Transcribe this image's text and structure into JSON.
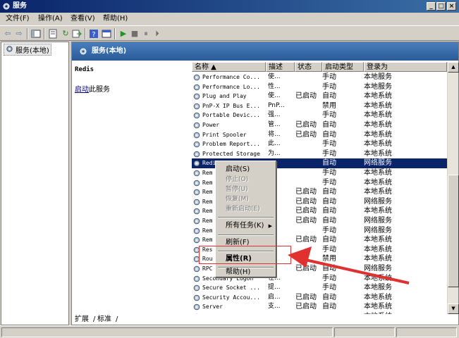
{
  "window": {
    "title": "服务",
    "buttons": [
      "_",
      "□",
      "×"
    ]
  },
  "menu": {
    "items": [
      "文件(F)",
      "操作(A)",
      "查看(V)",
      "帮助(H)"
    ]
  },
  "tree": {
    "root_label": "服务(本地)"
  },
  "panel": {
    "header": "服务(本地)",
    "selected_service": "Redis",
    "start_link": "启动",
    "start_link_suffix": "此服务"
  },
  "columns": [
    "名称 ▲",
    "描述",
    "状态",
    "启动类型",
    "登录为"
  ],
  "services": [
    {
      "name": "Performance Co...",
      "desc": "使...",
      "status": "",
      "startup": "手动",
      "logon": "本地服务"
    },
    {
      "name": "Performance Lo...",
      "desc": "性...",
      "status": "",
      "startup": "手动",
      "logon": "本地服务"
    },
    {
      "name": "Plug and Play",
      "desc": "使...",
      "status": "已启动",
      "startup": "自动",
      "logon": "本地系统"
    },
    {
      "name": "PnP-X IP Bus E...",
      "desc": "PnP...",
      "status": "",
      "startup": "禁用",
      "logon": "本地系统"
    },
    {
      "name": "Portable Devic...",
      "desc": "强...",
      "status": "",
      "startup": "手动",
      "logon": "本地系统"
    },
    {
      "name": "Power",
      "desc": "管...",
      "status": "已启动",
      "startup": "自动",
      "logon": "本地系统"
    },
    {
      "name": "Print Spooler",
      "desc": "将...",
      "status": "已启动",
      "startup": "自动",
      "logon": "本地系统"
    },
    {
      "name": "Problem Report...",
      "desc": "此...",
      "status": "",
      "startup": "手动",
      "logon": "本地系统"
    },
    {
      "name": "Protected Storage",
      "desc": "为...",
      "status": "",
      "startup": "手动",
      "logon": "本地系统"
    },
    {
      "name": "Redis",
      "desc": "",
      "status": "",
      "startup": "自动",
      "logon": "网络服务"
    },
    {
      "name": "Rem",
      "desc": "...",
      "status": "",
      "startup": "手动",
      "logon": "本地系统"
    },
    {
      "name": "Rem",
      "desc": "...",
      "status": "",
      "startup": "手动",
      "logon": "本地系统"
    },
    {
      "name": "Rem",
      "desc": "...",
      "status": "已启动",
      "startup": "自动",
      "logon": "本地系统"
    },
    {
      "name": "Rem",
      "desc": "...",
      "status": "已启动",
      "startup": "自动",
      "logon": "网络服务"
    },
    {
      "name": "Rem",
      "desc": "...",
      "status": "已启动",
      "startup": "自动",
      "logon": "本地系统"
    },
    {
      "name": "Rem",
      "desc": "...",
      "status": "已启动",
      "startup": "自动",
      "logon": "网络服务"
    },
    {
      "name": "Rem",
      "desc": "...",
      "status": "",
      "startup": "手动",
      "logon": "网络服务"
    },
    {
      "name": "Rem",
      "desc": "...",
      "status": "已启动",
      "startup": "自动",
      "logon": "本地系统"
    },
    {
      "name": "Res",
      "desc": "...",
      "status": "",
      "startup": "手动",
      "logon": "本地系统"
    },
    {
      "name": "Rou",
      "desc": "...",
      "status": "",
      "startup": "禁用",
      "logon": "本地系统"
    },
    {
      "name": "RPC",
      "desc": "...",
      "status": "已启动",
      "startup": "自动",
      "logon": "网络服务"
    },
    {
      "name": "Secondary Logon",
      "desc": "在...",
      "status": "",
      "startup": "手动",
      "logon": "本地系统"
    },
    {
      "name": "Secure Socket ...",
      "desc": "提...",
      "status": "",
      "startup": "手动",
      "logon": "本地服务"
    },
    {
      "name": "Security Accou...",
      "desc": "启...",
      "status": "已启动",
      "startup": "自动",
      "logon": "本地系统"
    },
    {
      "name": "Server",
      "desc": "支...",
      "status": "已启动",
      "startup": "自动",
      "logon": "本地系统"
    },
    {
      "name": "",
      "desc": "",
      "status": "",
      "startup": "",
      "logon": "本地系统"
    }
  ],
  "selected_index": 9,
  "context_menu": [
    {
      "label": "启动(S)",
      "enabled": true
    },
    {
      "label": "停止(O)",
      "enabled": false
    },
    {
      "label": "暂停(U)",
      "enabled": false
    },
    {
      "label": "恢复(M)",
      "enabled": false
    },
    {
      "label": "重新启动(E)",
      "enabled": false
    },
    {
      "label": "所有任务(K)",
      "enabled": true,
      "submenu": true
    },
    {
      "label": "刷新(F)",
      "enabled": true
    },
    {
      "label": "属性(R)",
      "enabled": true,
      "bold": true
    },
    {
      "label": "帮助(H)",
      "enabled": true
    }
  ],
  "tabs": [
    "扩展",
    "标准"
  ],
  "annotation": {
    "highlight_color": "#e03030",
    "arrow_color": "#e03030"
  },
  "colors": {
    "title_bar": "#0a246a",
    "selection": "#0a246a",
    "panel_header": "#3a6ea5"
  }
}
